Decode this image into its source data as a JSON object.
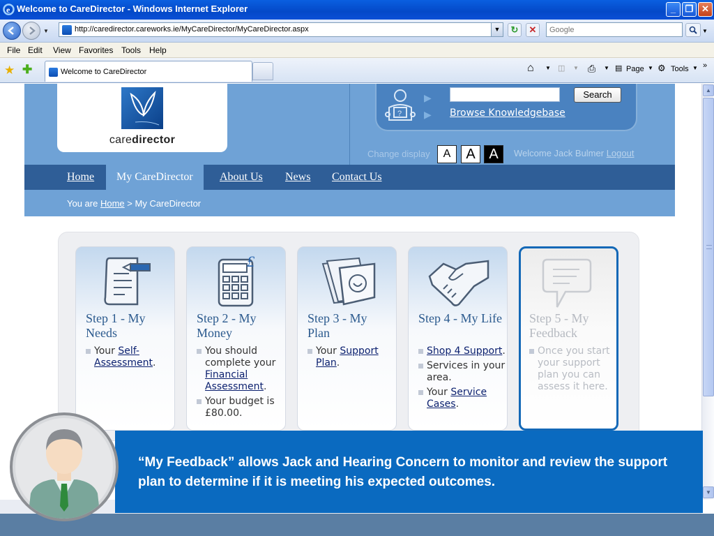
{
  "window": {
    "title": "Welcome to CareDirector - Windows Internet Explorer",
    "minimize": "_",
    "maximize": "❐",
    "close": "✕"
  },
  "address": {
    "url": "http://caredirector.careworks.ie/MyCareDirector/MyCareDirector.aspx",
    "search_placeholder": "Google"
  },
  "menu": [
    "File",
    "Edit",
    "View",
    "Favorites",
    "Tools",
    "Help"
  ],
  "tab": {
    "title": "Welcome to CareDirector"
  },
  "commands": {
    "page": "Page",
    "tools": "Tools"
  },
  "header": {
    "logo_text_light": "care",
    "logo_text_bold": "director",
    "search_button": "Search",
    "kb_link": "Browse Knowledgebase",
    "change_display": "Change display",
    "font_small": "A",
    "font_medium": "A",
    "font_large": "A",
    "welcome": "Welcome Jack Bulmer",
    "logout": "Logout"
  },
  "nav": {
    "items": [
      "Home",
      "My CareDirector",
      "About Us",
      "News",
      "Contact Us"
    ]
  },
  "breadcrumb": {
    "prefix": "You are",
    "home": "Home",
    "separator": ">",
    "current": "My CareDirector"
  },
  "steps": [
    {
      "title": "Step 1 - My Needs",
      "items": [
        {
          "before": "Your ",
          "link": "Self-Assessment",
          "after": "."
        }
      ]
    },
    {
      "title": "Step 2 - My Money",
      "items": [
        {
          "before": "You should complete your ",
          "link": "Financial Assessment",
          "after": "."
        },
        {
          "before": "Your budget is £80.00.",
          "link": "",
          "after": ""
        }
      ]
    },
    {
      "title": "Step 3 - My Plan",
      "items": [
        {
          "before": "Your ",
          "link": "Support Plan",
          "after": "."
        }
      ]
    },
    {
      "title": "Step 4 - My Life",
      "items": [
        {
          "before": "",
          "link": "Shop 4 Support",
          "after": "."
        },
        {
          "before": "Services in your area.",
          "link": "",
          "after": ""
        },
        {
          "before": "Your ",
          "link": "Service Cases",
          "after": "."
        }
      ]
    },
    {
      "title": "Step 5 - My Feedback",
      "items": [
        {
          "before": "Once you start your support plan you can assess it here.",
          "link": "",
          "after": ""
        }
      ]
    }
  ],
  "caption": {
    "text": "“My Feedback” allows Jack and Hearing Concern to monitor and review the support plan to determine if it is meeting his expected outcomes."
  },
  "colors": {
    "header_blue": "#6fa2d6",
    "nav_blue": "#2f5e97",
    "caption_blue": "#0a6ac0",
    "highlight_border": "#1368b7"
  },
  "icons": {
    "step1": "document-pen-icon",
    "step2": "calculator-icon",
    "step3": "folder-icon",
    "step4": "handshake-icon",
    "step5": "speech-bubble-icon"
  }
}
